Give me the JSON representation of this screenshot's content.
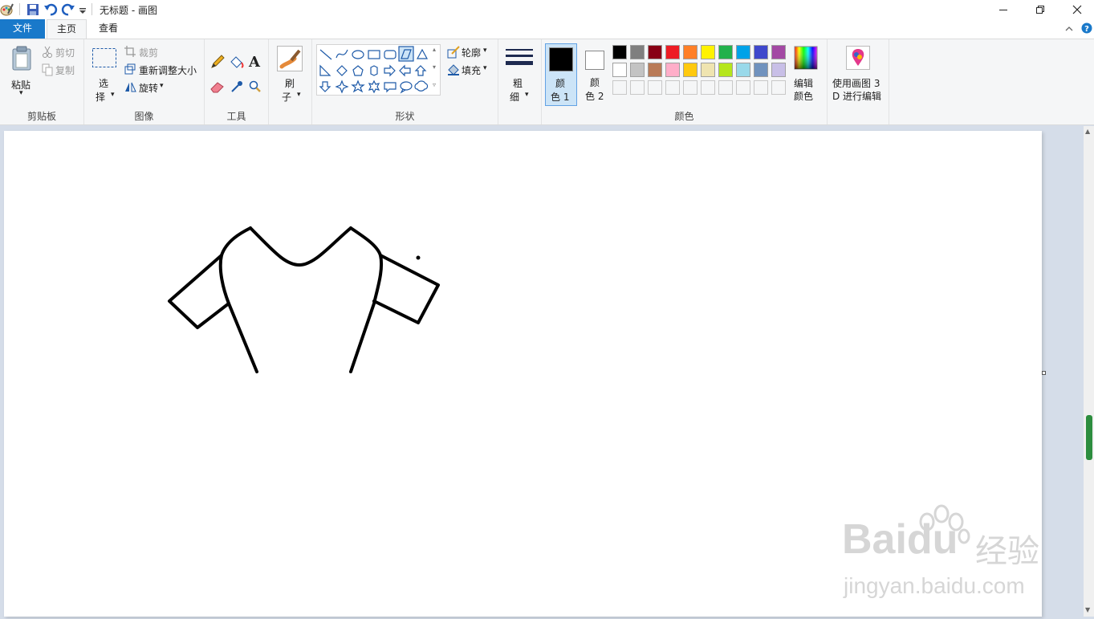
{
  "window": {
    "title": "无标题 - 画图"
  },
  "tabs": {
    "file": "文件",
    "home": "主页",
    "view": "查看"
  },
  "clipboard": {
    "paste": "粘贴",
    "cut": "剪切",
    "copy": "复制",
    "group": "剪贴板"
  },
  "image": {
    "select_top": "选",
    "select_bottom": "择",
    "crop": "裁剪",
    "resize": "重新调整大小",
    "rotate": "旋转",
    "group": "图像"
  },
  "tools": {
    "group": "工具"
  },
  "brushes": {
    "label_top": "刷",
    "label_bottom": "子"
  },
  "shapes": {
    "outline": "轮廓",
    "fill": "填充",
    "group": "形状"
  },
  "size": {
    "label_top": "粗",
    "label_bottom": "细"
  },
  "colors": {
    "color1_top": "颜",
    "color1_bottom": "色 1",
    "color2_top": "颜",
    "color2_bottom": "色 2",
    "edit_top": "编辑",
    "edit_bottom": "颜色",
    "group": "颜色",
    "color1_value": "#000000",
    "color2_value": "#ffffff",
    "palette_row1": [
      "#000000",
      "#7f7f7f",
      "#880015",
      "#ed1c24",
      "#ff7f27",
      "#fff200",
      "#22b14c",
      "#00a2e8",
      "#3f48cc",
      "#a349a4"
    ],
    "palette_row2": [
      "#ffffff",
      "#c3c3c3",
      "#b97a57",
      "#ffaec9",
      "#ffc90e",
      "#efe4b0",
      "#b5e61d",
      "#99d9ea",
      "#7092be",
      "#c8bfe7"
    ]
  },
  "paint3d": {
    "line1": "使用画图 3",
    "line2": "D 进行编辑"
  },
  "watermark": {
    "brand": "Baidu",
    "brand_cn": "经验",
    "url": "jingyan.baidu.com"
  }
}
